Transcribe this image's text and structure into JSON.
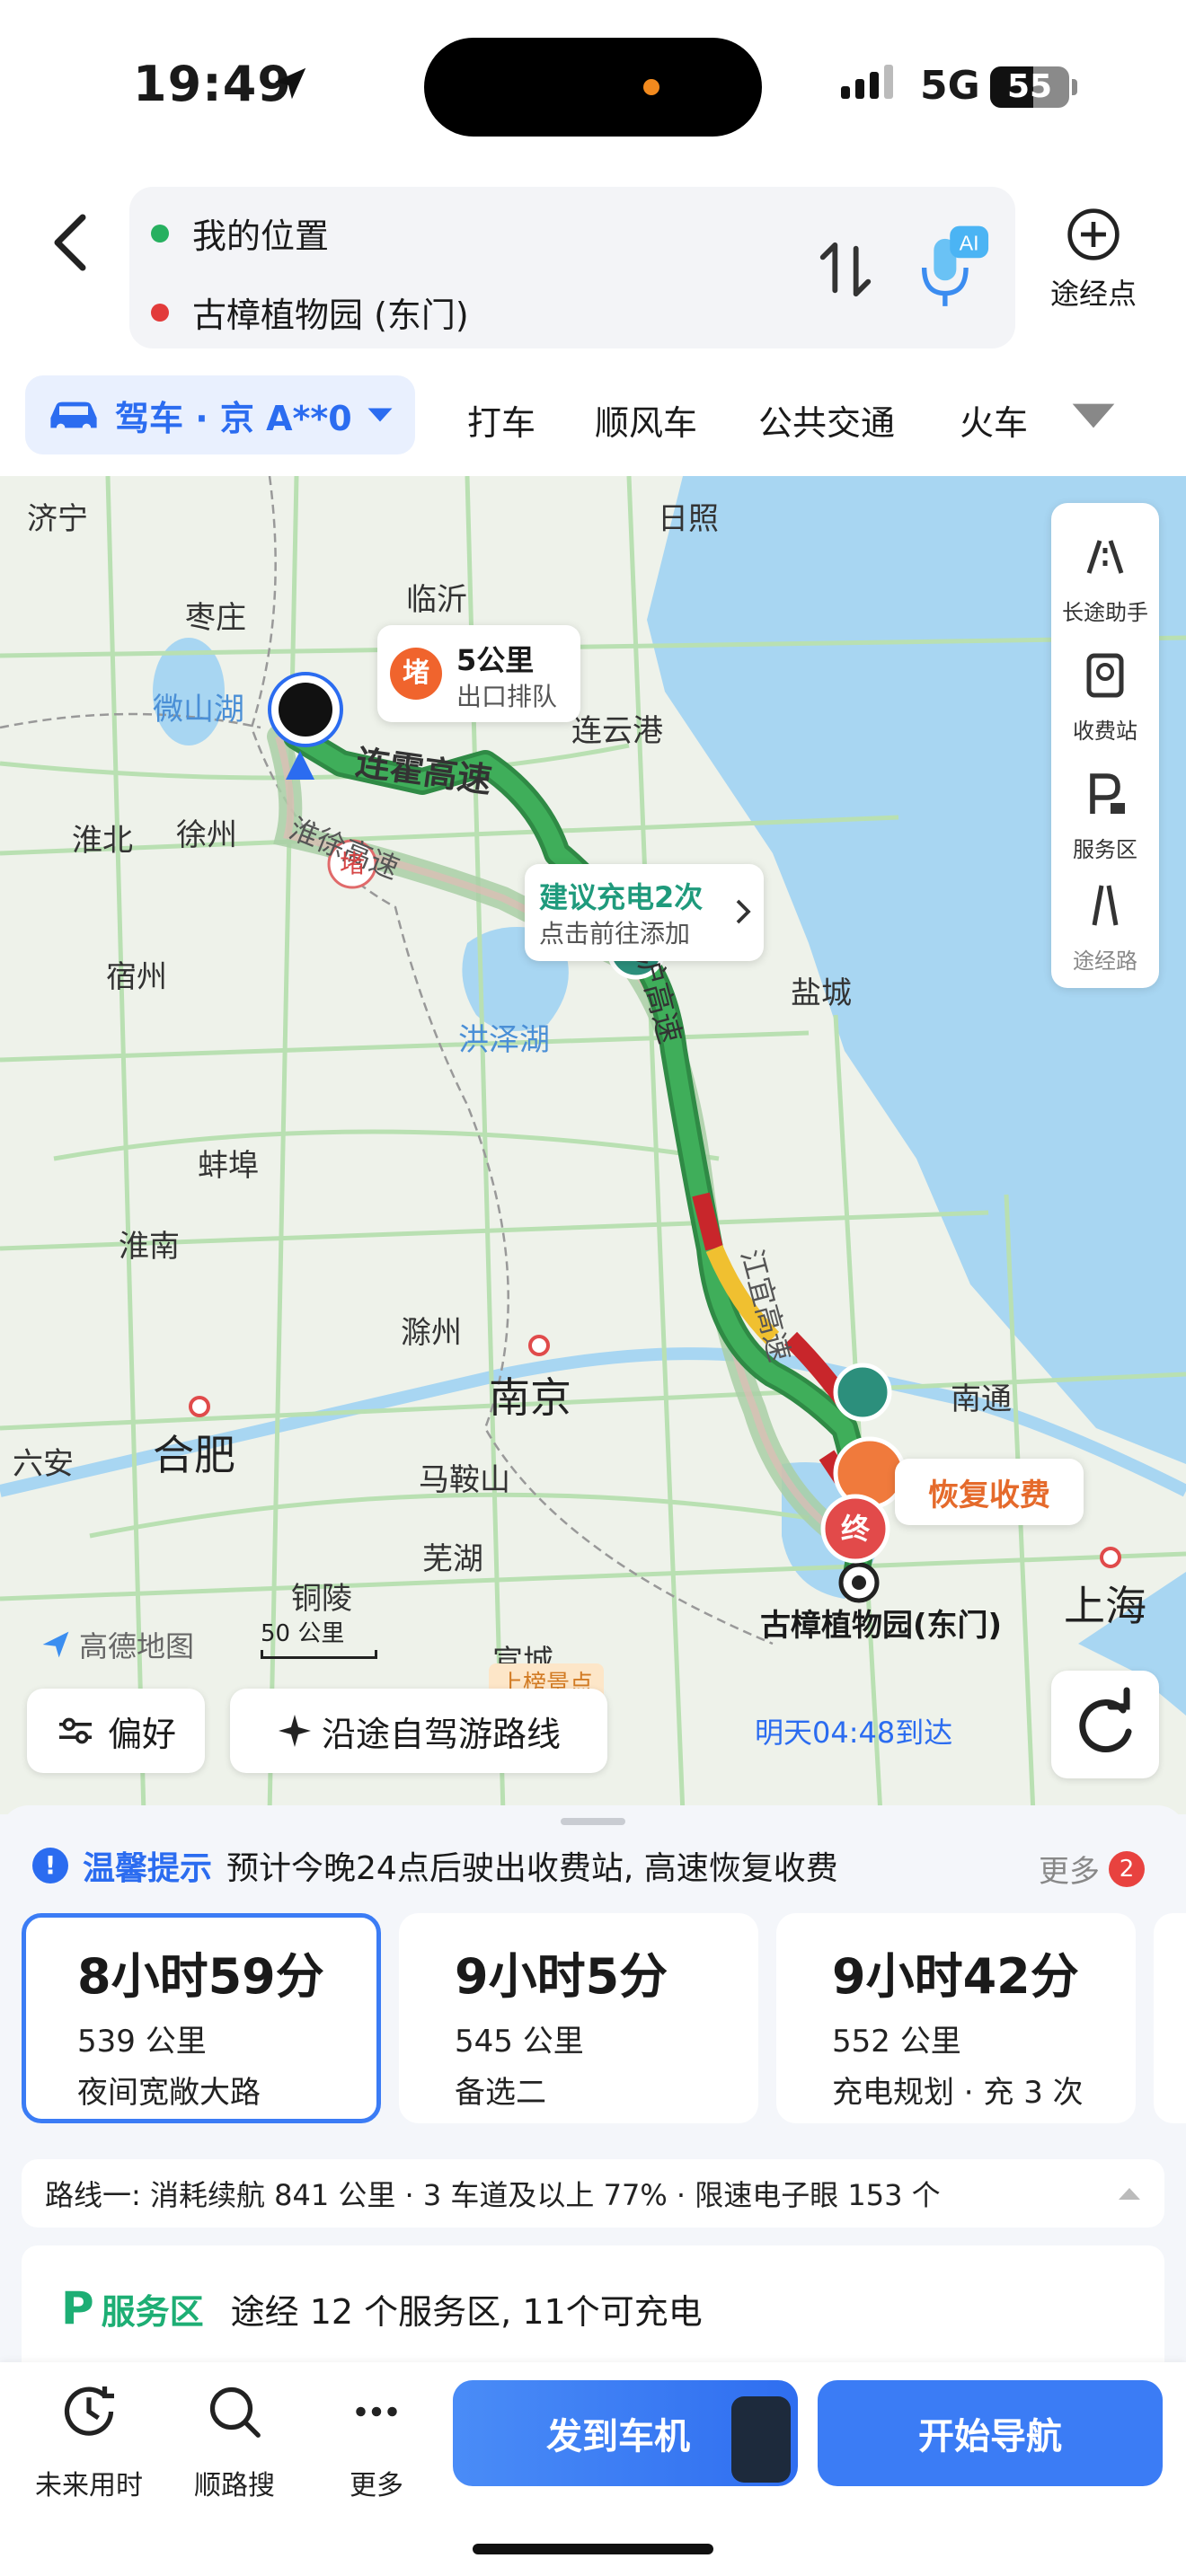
{
  "status_bar": {
    "time": "19:49",
    "network": "5G",
    "battery": "55",
    "battery_level": 0.55
  },
  "route": {
    "origin": "我的位置",
    "destination": "古樟植物园 (东门)",
    "waypoint_label": "途经点",
    "ai_label": "AI",
    "origin_color": "#27b060",
    "destination_color": "#e23b3b"
  },
  "modes": {
    "drive_label": "驾车 · 京 A**0",
    "tabs": [
      "打车",
      "顺风车",
      "公共交通",
      "火车"
    ]
  },
  "map": {
    "cities": [
      "济宁",
      "日照",
      "枣庄",
      "临沂",
      "微山湖",
      "连云港",
      "淮北",
      "徐州",
      "宿州",
      "洪泽湖",
      "盐城",
      "蚌埠",
      "淮南",
      "滁州",
      "南京",
      "南通",
      "六安",
      "合肥",
      "马鞍山",
      "芜湖",
      "铜陵",
      "宣城",
      "上海"
    ],
    "road_labels": [
      "连霍高速",
      "淮徐高速",
      "京沪高速",
      "江宜高速"
    ],
    "jam_callout": {
      "badge": "堵",
      "title": "5公里",
      "subtitle": "出口排队"
    },
    "jam_marker": "堵",
    "charge_callout": {
      "title": "建议充电2次",
      "subtitle": "点击前往添加"
    },
    "toll_callout": "恢复收费",
    "end_marker": "终",
    "destination_label": "古樟植物园(东门)",
    "eta": "明天04:48到达",
    "scale": "50 公里",
    "logo": "高德地图",
    "side_panel": [
      "长途助手",
      "收费站",
      "服务区",
      "途经路"
    ],
    "preference_button": "偏好",
    "trip_button": "沿途自驾游路线",
    "trip_tag": "上榜景点",
    "route_colors": {
      "smooth": "#3fae5a",
      "slow": "#f0c030",
      "jam": "#c8262b",
      "alt": "#a9cfa6"
    }
  },
  "tip": {
    "title": "温馨提示",
    "text": "预计今晚24点后驶出收费站, 高速恢复收费",
    "more": "更多",
    "count": "2"
  },
  "routes": [
    {
      "duration": "8小时59分",
      "distance": "539 公里",
      "tag": "夜间宽敞大路"
    },
    {
      "duration": "9小时5分",
      "distance": "545 公里",
      "tag": "备选二"
    },
    {
      "duration": "9小时42分",
      "distance": "552 公里",
      "tag": "充电规划 · 充 3 次"
    }
  ],
  "summary": "路线一: 消耗续航 841 公里 · 3 车道及以上 77% · 限速电子眼 153 个",
  "service": {
    "label": "服务区",
    "text": "途经 12 个服务区, 11个可充电"
  },
  "bottom": {
    "items": [
      "未来用时",
      "顺路搜",
      "更多"
    ],
    "send_button": "发到车机",
    "nav_button": "开始导航"
  }
}
